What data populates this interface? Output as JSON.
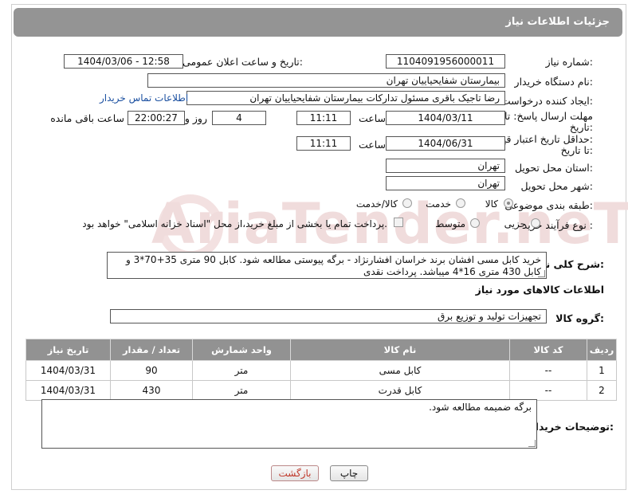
{
  "header": {
    "title": "جزئیات اطلاعات نیاز"
  },
  "fields": {
    "need_number_label": "شماره نیاز:",
    "need_number": "1104091956000011",
    "announce_label": "تاریخ و ساعت اعلان عمومی:",
    "announce_value": "1404/03/06 - 12:58",
    "buyer_org_label": "نام دستگاه خریدار:",
    "buyer_org": "بیمارستان شفایحیاییان تهران",
    "creator_label": "ایجاد کننده درخواست:",
    "creator": "رضا تاجیک باقری مسئول تدارکات بیمارستان شفایحیاییان تهران",
    "contact_link": "اطلاعات تماس خریدار",
    "deadline_label_1": "مهلت ارسال پاسخ: تا",
    "deadline_label_2": "تاریخ:",
    "deadline_date": "1404/03/11",
    "time_label": "ساعت",
    "deadline_time": "11:11",
    "days_value": "4",
    "days_label": "روز و",
    "remaining_time": "22:00:27",
    "remaining_label": "ساعت باقی مانده",
    "validity_label_1": "حداقل تاریخ اعتبار قیمت:",
    "validity_label_2": "تا تاریخ:",
    "validity_date": "1404/06/31",
    "validity_time": "11:11",
    "province_label": "استان محل تحویل:",
    "province": "تهران",
    "city_label": "شهر محل تحویل:",
    "city": "تهران",
    "category_label": "طبقه بندی موضوعی:",
    "category_options": [
      "کالا",
      "خدمت",
      "کالا/خدمت"
    ],
    "process_label": "نوع فرآیند خرید :",
    "process_options": [
      "جزیی",
      "متوسط"
    ],
    "payment_note": "پرداخت تمام یا بخشی از مبلغ خرید،از محل \"اسناد خزانه اسلامی\" خواهد بود."
  },
  "description": {
    "label": "شرح کلی نیاز:",
    "text": "خرید کابل مسی افشان برند خراسان افشارنژاد - برگه پیوستی مطالعه شود. کابل 90 متری 35+70*3 و کابل 430 متری 16*4 میباشد. پرداخت نقدی"
  },
  "goods": {
    "section_title": "اطلاعات کالاهای مورد نیاز",
    "group_label": "گروه کالا:",
    "group_value": "تجهیزات تولید و توزیع برق",
    "columns": [
      "ردیف",
      "کد کالا",
      "نام کالا",
      "واحد شمارش",
      "تعداد / مقدار",
      "تاریخ نیاز"
    ],
    "rows": [
      {
        "row": "1",
        "code": "--",
        "name": "کابل مسی",
        "unit": "متر",
        "qty": "90",
        "date": "1404/03/31"
      },
      {
        "row": "2",
        "code": "--",
        "name": "کابل قدرت",
        "unit": "متر",
        "qty": "430",
        "date": "1404/03/31"
      }
    ]
  },
  "buyer_notes": {
    "label": "توضیحات خریدار:",
    "text": "برگه ضمیمه مطالعه شود."
  },
  "buttons": {
    "print": "چاپ",
    "back": "بازگشت"
  },
  "watermark": "AriaTender.neT"
}
